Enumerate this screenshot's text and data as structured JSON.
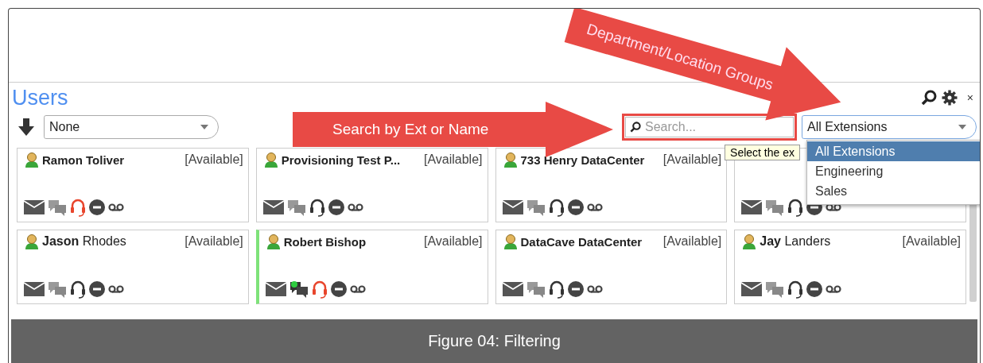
{
  "panel": {
    "title": "Users",
    "close": "×"
  },
  "toolbar": {
    "sort_select": {
      "value": "None"
    },
    "search": {
      "placeholder": "Search..."
    },
    "group_select": {
      "value": "All Extensions",
      "expanded": true,
      "options": [
        {
          "label": "All Extensions",
          "selected": true
        },
        {
          "label": "Engineering",
          "selected": false
        },
        {
          "label": "Sales",
          "selected": false
        }
      ]
    },
    "tooltip": "Select the ex"
  },
  "users": [
    {
      "name": "Ramon Toliver",
      "status": "[Available]",
      "on_call": true,
      "highlighted": false,
      "chat_online": false
    },
    {
      "name": "Provisioning Test P...",
      "status": "[Available]",
      "on_call": false,
      "highlighted": false,
      "chat_online": false
    },
    {
      "name": "733 Henry DataCenter",
      "status": "[Available]",
      "on_call": false,
      "highlighted": false,
      "chat_online": false
    },
    {
      "on_call": false,
      "highlighted": false,
      "chat_online": false
    },
    {
      "name": "**Jason** Rhodes",
      "status": "[Available]",
      "on_call": false,
      "highlighted": false,
      "chat_online": false
    },
    {
      "name": "Robert Bishop",
      "status": "[Available]",
      "on_call": true,
      "highlighted": true,
      "chat_online": true
    },
    {
      "name": "DataCave DataCenter",
      "status": "[Available]",
      "on_call": false,
      "highlighted": false,
      "chat_online": false
    },
    {
      "name": "**Jay** Landers",
      "status": "[Available]",
      "on_call": false,
      "highlighted": false,
      "chat_online": false
    }
  ],
  "annotations": [
    {
      "kind": "horizontal",
      "label": "Search by Ext or Name"
    },
    {
      "kind": "diagonal",
      "label": "Department/Location Groups"
    }
  ],
  "caption": "Figure 04: Filtering"
}
